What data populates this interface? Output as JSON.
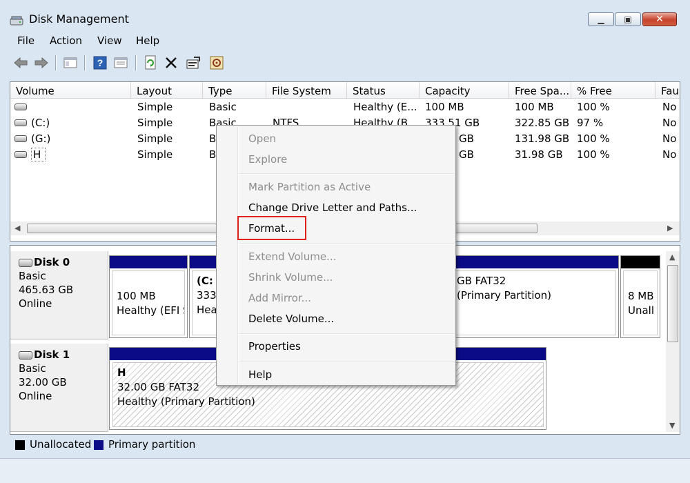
{
  "window": {
    "title": "Disk Management"
  },
  "menubar": [
    "File",
    "Action",
    "View",
    "Help"
  ],
  "toolbar_icons": [
    "back-icon",
    "forward-icon",
    "show-hide-console-icon",
    "help-icon",
    "properties-view-icon",
    "refresh-icon",
    "delete-icon",
    "properties-icon",
    "settings-icon"
  ],
  "volume_list": {
    "columns": [
      "Volume",
      "Layout",
      "Type",
      "File System",
      "Status",
      "Capacity",
      "Free Spa...",
      "% Free",
      "Fau"
    ],
    "rows": [
      {
        "volume": "",
        "layout": "Simple",
        "type": "Basic",
        "fs": "",
        "status": "Healthy (E...",
        "capacity": "100 MB",
        "free": "100 MB",
        "pct": "100 %",
        "fault": "No"
      },
      {
        "volume": "(C:)",
        "layout": "Simple",
        "type": "Basic",
        "fs": "NTFS",
        "status": "Healthy (B...",
        "capacity": "333.51 GB",
        "free": "322.85 GB",
        "pct": "97 %",
        "fault": "No"
      },
      {
        "volume": "(G:)",
        "layout": "Simple",
        "type": "B",
        "fs": "",
        "status": "",
        "capacity": "GB",
        "free": "131.98 GB",
        "pct": "100 %",
        "fault": "No"
      },
      {
        "volume": "H",
        "layout": "Simple",
        "type": "B",
        "fs": "",
        "status": "",
        "capacity": "GB",
        "free": "31.98 GB",
        "pct": "100 %",
        "fault": "No"
      }
    ]
  },
  "disks": [
    {
      "name": "Disk 0",
      "type": "Basic",
      "size": "465.63 GB",
      "state": "Online",
      "partitions": [
        {
          "line1": "100 MB",
          "line2": "Healthy (EFI S"
        },
        {
          "line1": "(C:",
          "line2": "333.",
          "line3": "Hea"
        },
        {
          "line1": "GB FAT32",
          "line2": "(Primary Partition)"
        },
        {
          "line1": "8 MB",
          "line2": "Unall"
        }
      ]
    },
    {
      "name": "Disk 1",
      "type": "Basic",
      "size": "32.00 GB",
      "state": "Online",
      "partitions": [
        {
          "label": "H",
          "line1": "32.00 GB FAT32",
          "line2": "Healthy (Primary Partition)"
        }
      ]
    }
  ],
  "legend": [
    {
      "label": "Unallocated",
      "color": "#000000"
    },
    {
      "label": "Primary partition",
      "color": "#0b0b87"
    }
  ],
  "context_menu": {
    "items": [
      {
        "label": "Open",
        "enabled": false
      },
      {
        "label": "Explore",
        "enabled": false
      },
      {
        "label": "Mark Partition as Active",
        "enabled": false
      },
      {
        "label": "Change Drive Letter and Paths...",
        "enabled": true
      },
      {
        "label": "Format...",
        "enabled": true,
        "highlighted": true
      },
      {
        "label": "Extend Volume...",
        "enabled": false
      },
      {
        "label": "Shrink Volume...",
        "enabled": false
      },
      {
        "label": "Add Mirror...",
        "enabled": false
      },
      {
        "label": "Delete Volume...",
        "enabled": true
      },
      {
        "label": "Properties",
        "enabled": true
      },
      {
        "label": "Help",
        "enabled": true
      }
    ]
  },
  "colors": {
    "primary_partition": "#0b0b87",
    "unallocated": "#000000",
    "highlight_box": "#e0211b"
  }
}
